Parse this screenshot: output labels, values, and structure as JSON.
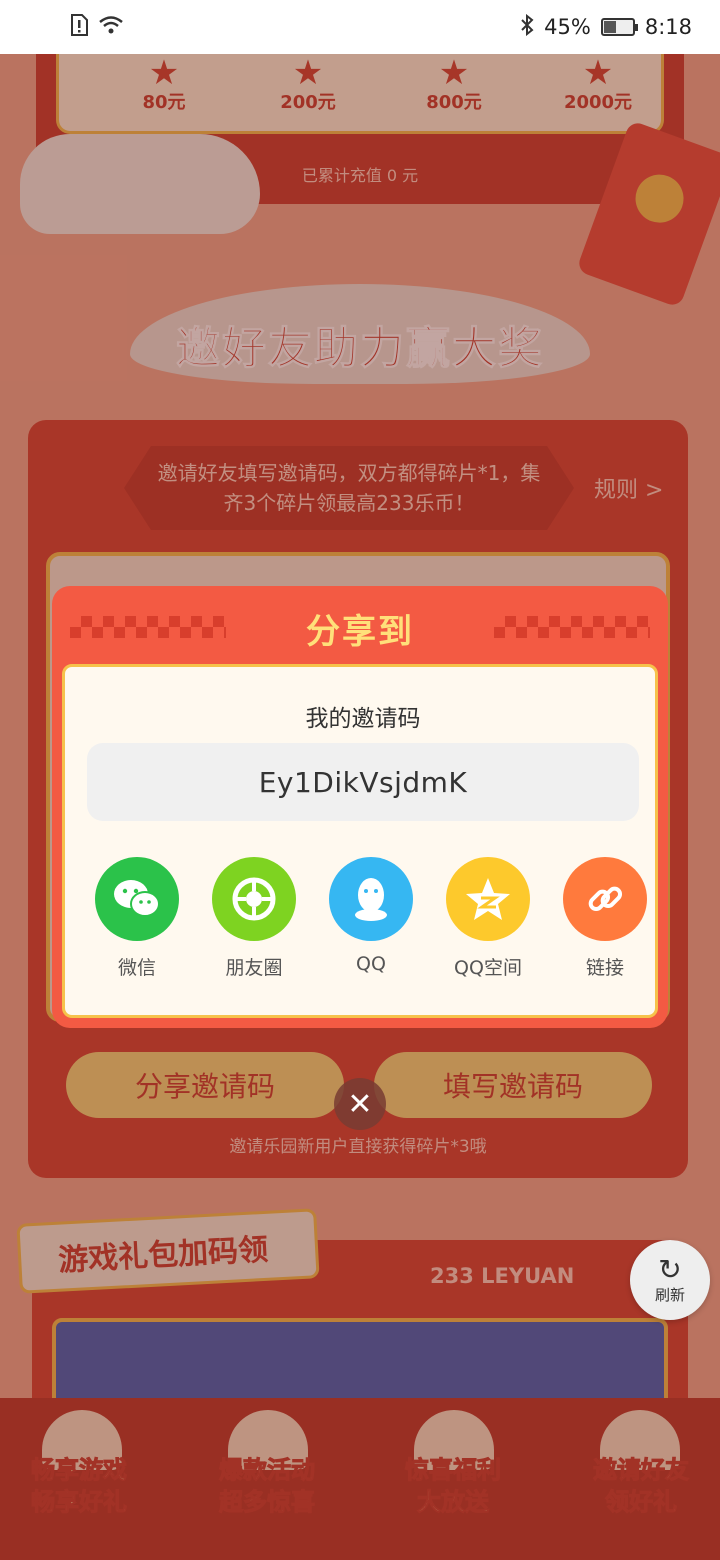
{
  "status_bar": {
    "battery": "45%",
    "battery_level": 0.45,
    "time": "8:18"
  },
  "recharge": {
    "tiers": [
      "80元",
      "200元",
      "800元",
      "2000元"
    ],
    "cumulative_text": "已累计充值 0 元"
  },
  "invite_section": {
    "title": "邀好友助力赢大奖",
    "description": "邀请好友填写邀请码，双方都得碎片*1，集齐3个碎片领最高233乐币！",
    "rules_label": "规则 >",
    "share_code_button": "分享邀请码",
    "fill_code_button": "填写邀请码",
    "note": "邀请乐园新用户直接获得碎片*3哦"
  },
  "gift_section": {
    "title": "游戏礼包加码领",
    "brand": "233 LEYUAN",
    "refresh_label": "刷新"
  },
  "bottom_nav": [
    {
      "line1": "畅享游戏",
      "line2": "畅享好礼"
    },
    {
      "line1": "爆款活动",
      "line2": "超多惊喜"
    },
    {
      "line1": "惊喜福利",
      "line2": "大放送"
    },
    {
      "line1": "邀请好友",
      "line2": "领好礼"
    }
  ],
  "dialog": {
    "title": "分享到",
    "code_label": "我的邀请码",
    "code_value": "Ey1DikVsjdmK",
    "share_targets": [
      {
        "label": "微信",
        "icon": "wechat-icon",
        "color": "#2bc24a"
      },
      {
        "label": "朋友圈",
        "icon": "moments-icon",
        "color": "#7ed321"
      },
      {
        "label": "QQ",
        "icon": "qq-icon",
        "color": "#36b7f2"
      },
      {
        "label": "QQ空间",
        "icon": "qzone-icon",
        "color": "#fdc92c"
      },
      {
        "label": "链接",
        "icon": "link-icon",
        "color": "#ff7a3d"
      }
    ]
  },
  "colors": {
    "accent_red": "#f35a43",
    "gold": "#f6c24b"
  }
}
